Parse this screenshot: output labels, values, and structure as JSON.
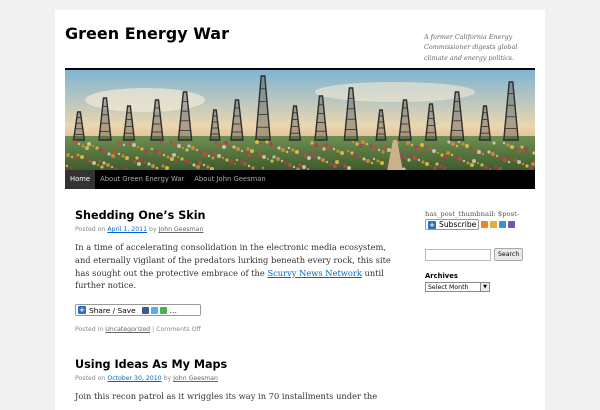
{
  "header": {
    "site_title": "Green Energy War",
    "site_description": "A former California Energy Commissioner digests global climate and energy politics."
  },
  "nav": {
    "items": [
      {
        "label": "Home"
      },
      {
        "label": "About Green Energy War"
      },
      {
        "label": "About John Geesman"
      }
    ]
  },
  "posts": [
    {
      "title": "Shedding One’s Skin",
      "posted_on": "Posted on",
      "date": "April 1, 2011",
      "by": "by",
      "author": "John Geesman",
      "body_before": "In a time of accelerating consolidation in the electronic media ecosystem, and eternally vigilant of the predators lurking beneath every rock, this site has sought out the protective embrace of the ",
      "body_link": "Scurvy News Network",
      "body_after": " until further notice.",
      "share_label": "Share / Save",
      "posted_in": "Posted in",
      "category": "Uncategorized",
      "separator": "|",
      "comments": "Comments Off"
    },
    {
      "title": "Using Ideas As My Maps",
      "posted_on": "Posted on",
      "date": "October 30, 2010",
      "by": "by",
      "author": "John Geesman",
      "body_before": "Join this recon patrol as it wriggles its way in 70 installments under the"
    }
  ],
  "sidebar": {
    "thumbnail_text": "has_post_thumbnail: $post-",
    "subscribe_label": "Subscribe",
    "search_placeholder": "",
    "search_button": "Search",
    "archives_title": "Archives",
    "archives_selected": "Select Month"
  },
  "colors": {
    "link": "#0066cc",
    "nav_bg": "#000000",
    "page_bg": "#f1f1f1"
  }
}
